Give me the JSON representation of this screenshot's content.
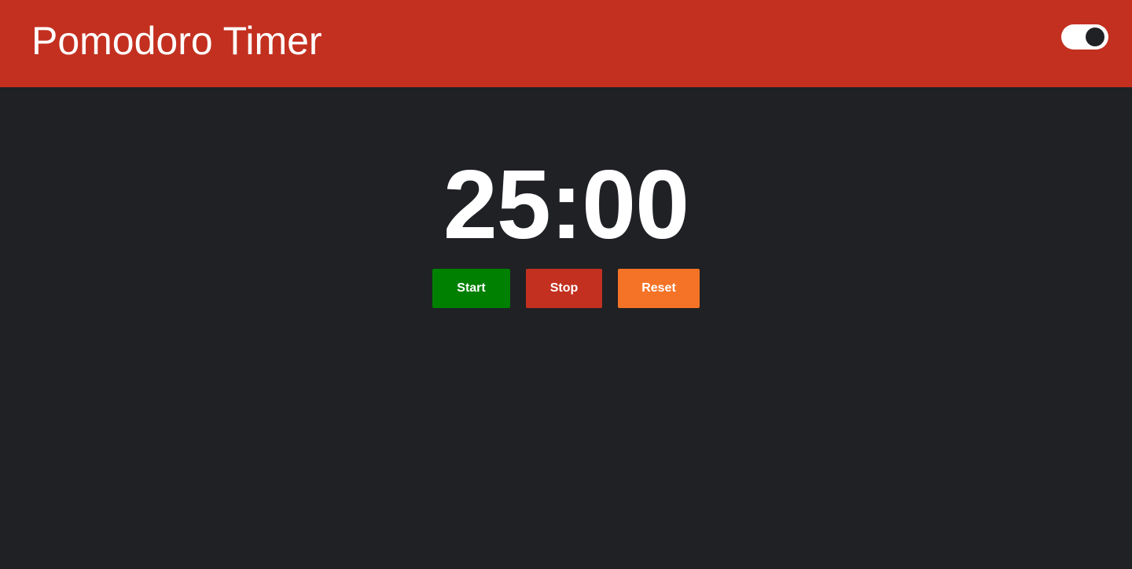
{
  "header": {
    "title": "Pomodoro Timer",
    "theme_toggle": {
      "state": "on"
    }
  },
  "timer": {
    "display": "25:00"
  },
  "controls": {
    "start_label": "Start",
    "stop_label": "Stop",
    "reset_label": "Reset"
  },
  "colors": {
    "header_bg": "#c33020",
    "page_bg": "#1f2125",
    "start": "#008000",
    "stop": "#c33020",
    "reset": "#f47326",
    "text": "#ffffff"
  }
}
